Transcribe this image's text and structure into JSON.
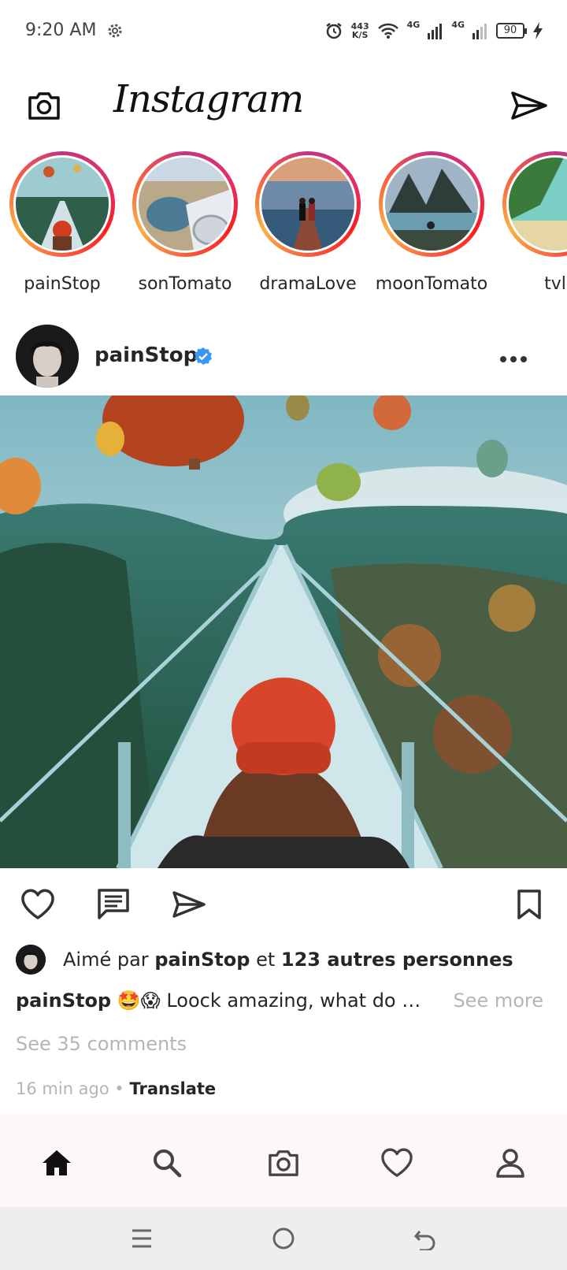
{
  "status_bar": {
    "time": "9:20 AM",
    "speed_value": "443",
    "speed_unit": "K/S",
    "net1": "4G",
    "net2": "4G",
    "battery": "90"
  },
  "header": {
    "brand": "Instagram"
  },
  "stories": [
    {
      "label": "painStop"
    },
    {
      "label": "sonTomato"
    },
    {
      "label": "dramaLove"
    },
    {
      "label": "moonTomato"
    },
    {
      "label": "tvl"
    }
  ],
  "post": {
    "username": "painStop",
    "liked_prefix": "Aimé par",
    "liked_user": "painStop",
    "liked_joiner": "et",
    "liked_others": "123 autres personnes",
    "caption_user": "painStop",
    "caption_emojis": "🤩😱",
    "caption_text": "Loock amazing, what do …",
    "see_more": "See more",
    "comments_link": "See 35 comments",
    "time_ago": "16 min ago",
    "separator": "•",
    "translate": "Translate"
  },
  "colors": {
    "accent_blue": "#3897f0",
    "muted_text": "#b5b5b5",
    "nav_bg": "#fdf6fb"
  }
}
